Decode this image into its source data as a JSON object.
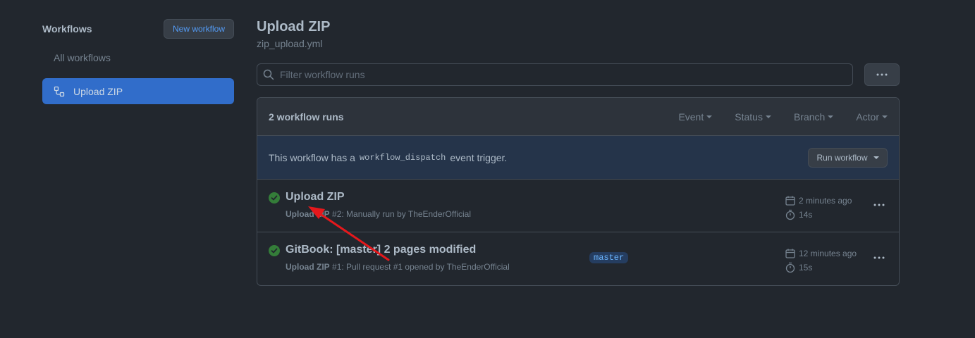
{
  "sidebar": {
    "title": "Workflows",
    "new_button": "New workflow",
    "all_workflows": "All workflows",
    "active_item": "Upload ZIP"
  },
  "header": {
    "title": "Upload ZIP",
    "file": "zip_upload.yml"
  },
  "search": {
    "placeholder": "Filter workflow runs"
  },
  "runs_box": {
    "count": "2 workflow runs",
    "filters": [
      "Event",
      "Status",
      "Branch",
      "Actor"
    ],
    "dispatch_prefix": "This workflow has a",
    "dispatch_code": "workflow_dispatch",
    "dispatch_suffix": "event trigger.",
    "run_button": "Run workflow"
  },
  "runs": [
    {
      "title": "Upload ZIP",
      "workflow": "Upload ZIP",
      "detail": "#2: Manually run by TheEnderOfficial",
      "branch": "",
      "time": "2 minutes ago",
      "duration": "14s",
      "status": "success"
    },
    {
      "title": "GitBook: [master] 2 pages modified",
      "workflow": "Upload ZIP",
      "detail": "#1: Pull request #1 opened by TheEnderOfficial",
      "branch": "master",
      "time": "12 minutes ago",
      "duration": "15s",
      "status": "success"
    }
  ],
  "colors": {
    "background": "#22272e",
    "accent": "#316dca",
    "success": "#347d39",
    "annotation_arrow": "#e5181c"
  }
}
